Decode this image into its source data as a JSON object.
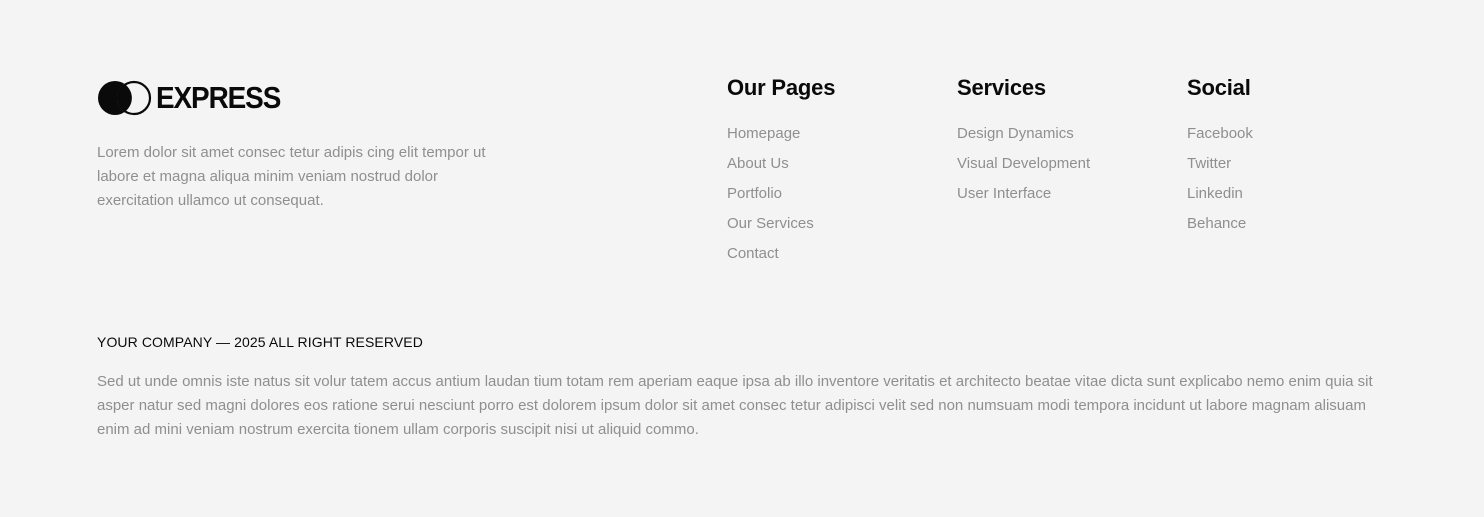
{
  "brand": {
    "name": "EXPRESS",
    "description": "Lorem dolor sit amet consec tetur adipis cing elit tempor ut labore et magna aliqua minim veniam nostrud dolor exercitation ullamco ut consequat."
  },
  "columns": {
    "pages": {
      "title": "Our Pages",
      "links": [
        "Homepage",
        "About Us",
        "Portfolio",
        "Our Services",
        "Contact"
      ]
    },
    "services": {
      "title": "Services",
      "links": [
        "Design Dynamics",
        "Visual Development",
        "User Interface"
      ]
    },
    "social": {
      "title": "Social",
      "links": [
        "Facebook",
        "Twitter",
        "Linkedin",
        "Behance"
      ]
    }
  },
  "copyright": "YOUR COMPANY — 2025 ALL RIGHT RESERVED",
  "bottom_description": "Sed ut unde omnis iste natus sit volur tatem accus antium laudan tium totam rem aperiam eaque ipsa ab illo inventore veritatis et architecto beatae vitae dicta sunt explicabo nemo enim quia sit asper natur sed magni dolores eos ratione serui nesciunt porro est dolorem ipsum dolor sit amet consec tetur adipisci velit sed non numsuam modi tempora incidunt ut labore magnam alisuam enim ad mini veniam nostrum exercita tionem ullam corporis suscipit nisi ut aliquid commo.",
  "colors": {
    "background": "#f4f4f4",
    "heading": "#0a0a0a",
    "muted": "#8f8f8f"
  },
  "icons": {
    "logo": "overlapping-circles-logo-icon"
  }
}
